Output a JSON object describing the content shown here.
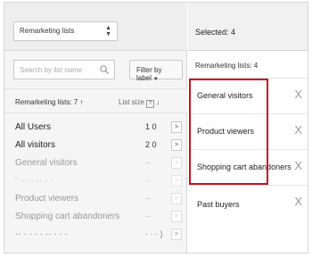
{
  "left": {
    "dropdown": {
      "label": "Remarketing lists",
      "arrows": "▲\n▼"
    },
    "search": {
      "placeholder": "Search by list name"
    },
    "filter": {
      "label": "Filter by label",
      "caret": "▼"
    },
    "columns": {
      "name": "Remarketing lists: 7",
      "sort_arrow": "↑",
      "size": "List size",
      "help": "?",
      "size_arrow": "↓"
    },
    "rows": [
      {
        "name": "All Users",
        "size": "1 0",
        "add": ">"
      },
      {
        "name": "All visitors",
        "size": "2 0",
        "add": ">"
      },
      {
        "name": "General visitors",
        "size": "--",
        "add": ">"
      },
      {
        "name": "' ·· ·· ·· · ·",
        "size": "--",
        "add": ">"
      },
      {
        "name": "Product viewers",
        "size": "--",
        "add": ">"
      },
      {
        "name": "Shopping cart abandoners",
        "size": "--",
        "add": ">"
      },
      {
        "name": "·· · · · · ·· · · ·",
        "size": "· · · )",
        "add": ">"
      }
    ]
  },
  "right": {
    "header": "Selected: 4",
    "subheader": "Remarketing lists: 4",
    "items": [
      {
        "label": "General visitors",
        "remove": "X"
      },
      {
        "label": "Product viewers",
        "remove": "X"
      },
      {
        "label": "Shopping cart abandoners",
        "remove": "X"
      },
      {
        "label": "Past buyers",
        "remove": "X"
      }
    ]
  },
  "colors": {
    "highlight": "#c8121c",
    "panel_bg": "#f5f5f5",
    "border": "#d6d6d6"
  }
}
